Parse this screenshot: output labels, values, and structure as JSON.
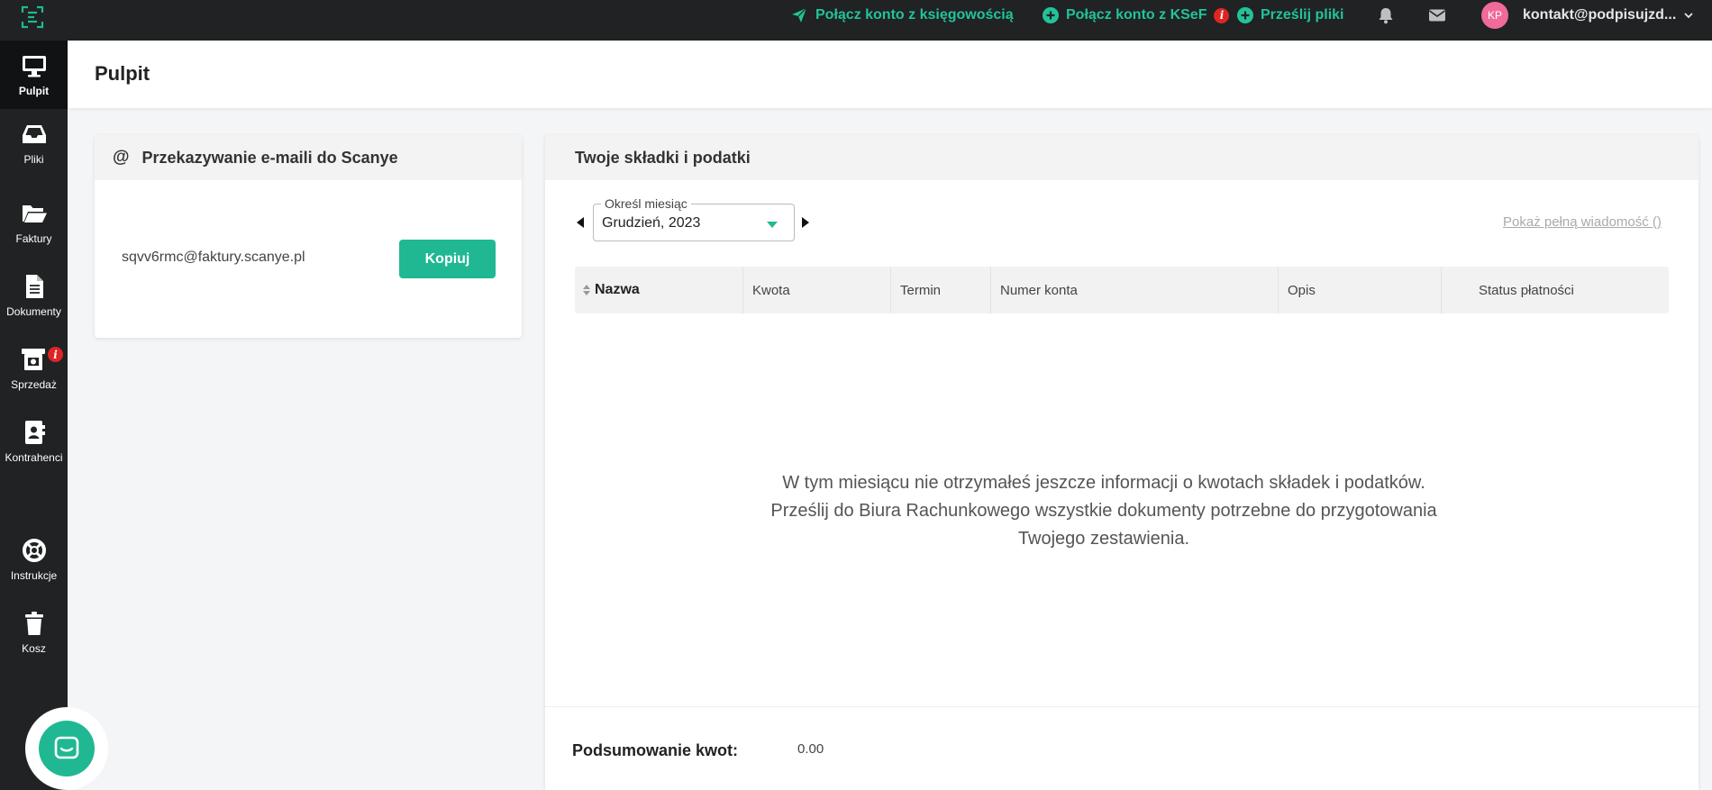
{
  "topbar": {
    "connect_accounting": "Połącz konto z księgowością",
    "connect_ksef": "Połącz konto z KSeF",
    "upload_files": "Prześlij pliki",
    "info_badge": "i",
    "avatar_initials": "KP",
    "account_email": "kontakt@podpisujzd..."
  },
  "sidebar": {
    "items": [
      {
        "label": "Pulpit",
        "icon": "monitor-icon"
      },
      {
        "label": "Pliki",
        "icon": "inbox-icon"
      },
      {
        "label": "Faktury",
        "icon": "folder-open-icon"
      },
      {
        "label": "Dokumenty",
        "icon": "document-icon"
      },
      {
        "label": "Sprzedaż",
        "icon": "cash-register-icon"
      },
      {
        "label": "Kontrahenci",
        "icon": "contact-book-icon"
      },
      {
        "label": "Instrukcje",
        "icon": "lifebuoy-icon"
      },
      {
        "label": "Kosz",
        "icon": "trash-icon"
      }
    ],
    "sales_badge": "i"
  },
  "page": {
    "title": "Pulpit"
  },
  "email_card": {
    "title": "Przekazywanie e-maili do Scanye",
    "email": "sqvv6rmc@faktury.scanye.pl",
    "copy_label": "Kopiuj"
  },
  "tax_card": {
    "title": "Twoje składki i podatki",
    "month_label": "Określ miesiąc",
    "month_value": "Grudzień, 2023",
    "full_message_link": "Pokaż pełną wiadomość ()",
    "columns": [
      "Nazwa",
      "Kwota",
      "Termin",
      "Numer konta",
      "Opis",
      "Status płatności"
    ],
    "empty_lines": [
      "W tym miesiącu nie otrzymałeś jeszcze informacji o kwotach składek i podatków.",
      "Prześlij do Biura Rachunkowego wszystkie dokumenty potrzebne do przygotowania",
      "Twojego zestawienia."
    ],
    "summary_label": "Podsumowanie kwot:",
    "summary_value": "0.00"
  },
  "colors": {
    "accent": "#1fb892",
    "topbar_bg": "#202223",
    "badge_red": "#e02424",
    "avatar_pink": "#f06a9b"
  }
}
